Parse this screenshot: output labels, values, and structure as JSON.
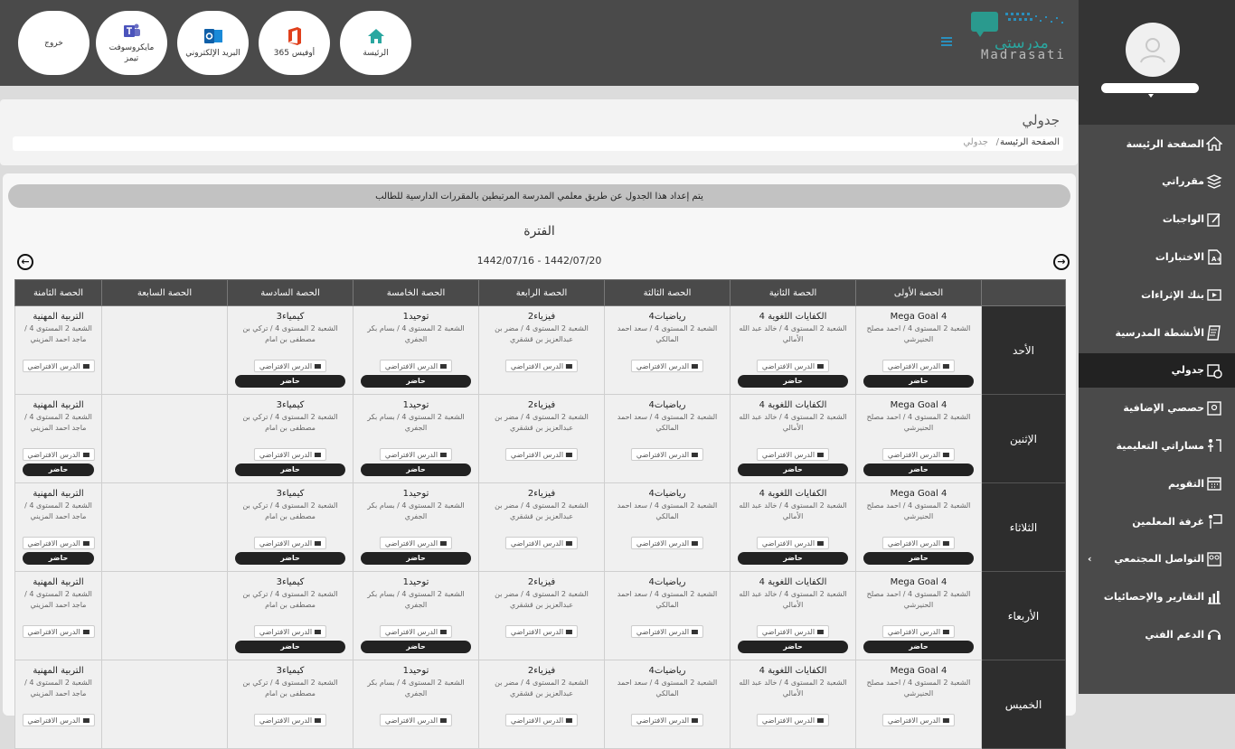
{
  "topbar": {
    "buttons": [
      {
        "label": "الرئيسة",
        "icon": "home-icon"
      },
      {
        "label": "أوفيس 365",
        "icon": "office-icon"
      },
      {
        "label": "البريد الإلكتروني",
        "icon": "outlook-icon"
      },
      {
        "label": "مايكروسوفت تيمز",
        "icon": "teams-icon"
      },
      {
        "label": "خروج",
        "icon": ""
      }
    ],
    "logo_text": "Madrasati",
    "logo_arabic": "مدرستي"
  },
  "sidebar": {
    "items": [
      {
        "label": "الصفحة الرئيسة",
        "icon": "home-icon"
      },
      {
        "label": "مقرراتي",
        "icon": "books-icon"
      },
      {
        "label": "الواجبات",
        "icon": "edit-icon"
      },
      {
        "label": "الاختبارات",
        "icon": "test-icon"
      },
      {
        "label": "بنك الإثراءات",
        "icon": "media-icon"
      },
      {
        "label": "الأنشطة المدرسية",
        "icon": "activity-icon"
      },
      {
        "label": "جدولي",
        "icon": "calendar-clock-icon",
        "active": true
      },
      {
        "label": "حصصي الإضافية",
        "icon": "extra-classes-icon"
      },
      {
        "label": "مساراتي التعليمية",
        "icon": "paths-icon"
      },
      {
        "label": "التقويم",
        "icon": "calendar-icon"
      },
      {
        "label": "غرفة المعلمين",
        "icon": "teacher-room-icon"
      },
      {
        "label": "التواصل المجتمعي",
        "icon": "community-icon"
      },
      {
        "label": "التقارير والإحصائيات",
        "icon": "chart-icon"
      },
      {
        "label": "الدعم الفني",
        "icon": "headset-icon"
      }
    ]
  },
  "header": {
    "title": "جدولي",
    "breadcrumb_home": "الصفحة الرئيسة",
    "breadcrumb_sep": "/",
    "breadcrumb_current": "جدولي"
  },
  "main": {
    "notice": "يتم إعداد هذا الجدول عن طريق معلمي المدرسة المرتبطين بالمقررات الدارسية للطالب",
    "period_title": "الفترة",
    "date_range": "1442/07/16 - 1442/07/20",
    "columns": [
      "الحصة الأولى",
      "الحصة الثانية",
      "الحصة الثالثة",
      "الحصة الرابعة",
      "الحصة الخامسة",
      "الحصة السادسة",
      "الحصة السابعة",
      "الحصة الثامنة"
    ],
    "days": [
      "الأحد",
      "الإثنين",
      "الثلاثاء",
      "الأربعاء",
      "الخميس"
    ],
    "virtual_label": "الدرس الافتراضي",
    "present_label": "حاضر",
    "slots": [
      {
        "subject": "Mega Goal 4",
        "detail": "الشعبة 2 المستوى 4 / احمد مصلح الحنيرشي"
      },
      {
        "subject": "الكفايات اللغوية 4",
        "detail": "الشعبة 2 المستوى 4 / خالد عبد الله الأمالي"
      },
      {
        "subject": "رياضيات4",
        "detail": "الشعبة 2 المستوى 4 / سعد احمد المالكي"
      },
      {
        "subject": "فيزياء2",
        "detail": "الشعبة 2 المستوى 4 / مضر بن عبدالعزيز بن قشقري"
      },
      {
        "subject": "توحيد1",
        "detail": "الشعبة 2 المستوى 4 / بسام بكر الجفري"
      },
      {
        "subject": "كيمياء3",
        "detail": "الشعبة 2 المستوى 4 / تركي بن مصطفى بن امام"
      },
      {
        "subject": "",
        "detail": ""
      },
      {
        "subject": "التربية المهنية",
        "detail": "الشعبة 2 المستوى 4 / ماجد احمد المزيني"
      }
    ],
    "present_matrix": [
      [
        true,
        true,
        false,
        false,
        true,
        true,
        false,
        false
      ],
      [
        true,
        true,
        false,
        false,
        true,
        true,
        false,
        true
      ],
      [
        true,
        true,
        false,
        false,
        true,
        true,
        false,
        true
      ],
      [
        true,
        true,
        false,
        false,
        true,
        true,
        false,
        false
      ],
      [
        false,
        false,
        false,
        false,
        false,
        false,
        false,
        false
      ]
    ]
  }
}
